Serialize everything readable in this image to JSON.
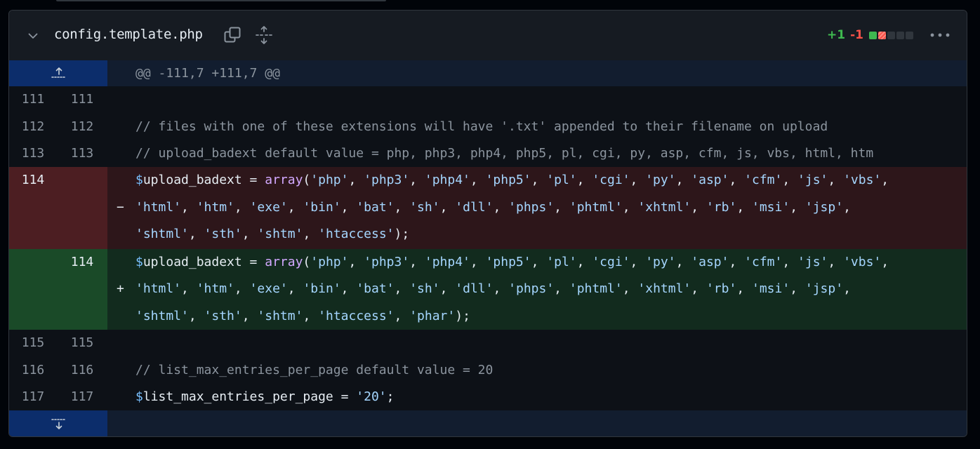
{
  "file": {
    "name": "config.template.php",
    "additions": "+1",
    "deletions": "-1",
    "diffstat_colors": [
      "#3fb950",
      "#f85149",
      "#30363d",
      "#30363d",
      "#30363d"
    ]
  },
  "icons": {
    "collapse": "chevron-down-icon",
    "copy": "copy-icon",
    "expand": "unfold-icon",
    "more": "kebab-horizontal-icon",
    "expand_up": "expand-up-icon",
    "expand_down": "expand-down-icon"
  },
  "colors": {
    "addition": "#3fb950",
    "deletion": "#f85149",
    "hunk_header_bg": "#121d2f"
  },
  "hunk_header": "@@ -111,7 +111,7 @@",
  "lines": [
    {
      "old": "111",
      "new": "111",
      "text": ""
    },
    {
      "old": "112",
      "new": "112",
      "text": "// files with one of these extensions will have '.txt' appended to their filename on upload"
    },
    {
      "old": "113",
      "new": "113",
      "text": "// upload_badext default value = php, php3, php4, php5, pl, cgi, py, asp, cfm, js, vbs, html, htm"
    },
    {
      "old": "114",
      "new": "",
      "marker": "−",
      "text_1": "$upload_badext = array('php', 'php3', 'php4', 'php5', 'pl', 'cgi', 'py', 'asp', 'cfm', 'js', 'vbs',",
      "text_2": "'html', 'htm', 'exe', 'bin', 'bat', 'sh', 'dll', 'phps', 'phtml', 'xhtml', 'rb', 'msi', 'jsp',",
      "text_3": "'shtml', 'sth', 'shtm', 'htaccess');"
    },
    {
      "old": "",
      "new": "114",
      "marker": "+",
      "text_1": "$upload_badext = array('php', 'php3', 'php4', 'php5', 'pl', 'cgi', 'py', 'asp', 'cfm', 'js', 'vbs',",
      "text_2": "'html', 'htm', 'exe', 'bin', 'bat', 'sh', 'dll', 'phps', 'phtml', 'xhtml', 'rb', 'msi', 'jsp',",
      "text_3": "'shtml', 'sth', 'shtm', 'htaccess', 'phar');"
    },
    {
      "old": "115",
      "new": "115",
      "text": ""
    },
    {
      "old": "116",
      "new": "116",
      "text": "// list_max_entries_per_page default value = 20"
    },
    {
      "old": "117",
      "new": "117",
      "text": "$list_max_entries_per_page = '20';"
    }
  ]
}
